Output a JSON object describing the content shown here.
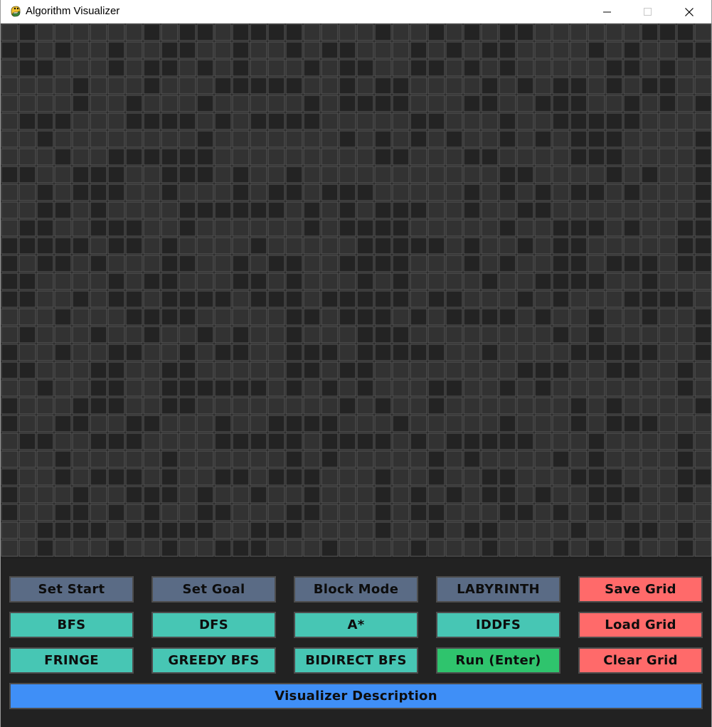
{
  "window": {
    "title": "Algorithm Visualizer"
  },
  "colors": {
    "grid_cell_light": "#323232",
    "grid_cell_dark": "#232323",
    "grid_line": "#5a5a5a",
    "panel_bg": "#222222",
    "mode_button": "#5a6b85",
    "algo_button": "#47c6b4",
    "run_button": "#2fc46d",
    "file_button": "#ff6a6a",
    "description_button": "#3f8ff7"
  },
  "controls": {
    "row1": [
      "Set Start",
      "Set Goal",
      "Block Mode",
      "LABYRINTH",
      "Save Grid"
    ],
    "row2": [
      "BFS",
      "DFS",
      "A*",
      "IDDFS",
      "Load Grid"
    ],
    "row3": [
      "FRINGE",
      "GREEDY BFS",
      "BIDIRECT BFS",
      "Run (Enter)",
      "Clear Grid"
    ],
    "description": "Visualizer Description"
  }
}
